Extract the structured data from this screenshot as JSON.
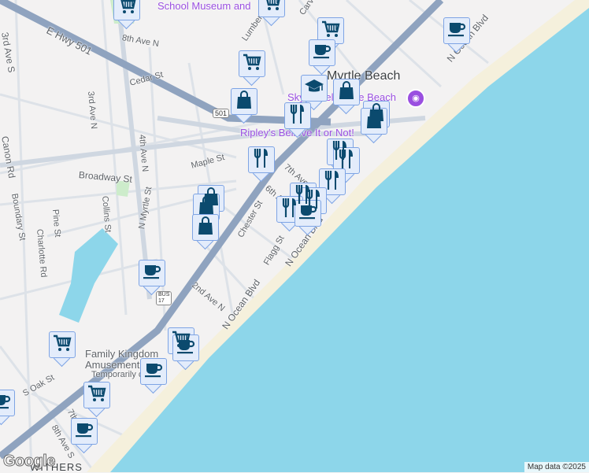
{
  "map": {
    "colors": {
      "water": "#8dd6ea",
      "land": "#f3f2f2",
      "highway": "#8fa3bf",
      "road": "#d6dde6",
      "beach": "#f5f0dc",
      "park": "#cdeccb",
      "marker_bg": "#e3ecfb",
      "icon": "#0b4a6e",
      "poi": "#9a4fe0"
    },
    "city_label": "Myrtle Beach",
    "poi_labels": [
      "Ripley's Believe It or Not!",
      "SkyWheel Myrtle Beach",
      "Family Kingdom Amusement Park",
      "Temporarily closed",
      "School Museum and"
    ],
    "street_labels": [
      "E Hwy 501",
      "8th Ave N",
      "3rd Ave S",
      "3rd Ave N",
      "Cedar St",
      "4th Ave N",
      "Canon Rd",
      "Broadway St",
      "Maple St",
      "Boundary St",
      "Collins St",
      "N Myrtle St",
      "Chester St",
      "Flagg St",
      "7th Ave N",
      "6th Ave N",
      "2nd Ave N",
      "N Ocean Blvd",
      "N Ocean Blvd",
      "N Ocean Blvd",
      "Lumber St",
      "Carver St",
      "Charlotte Rd",
      "S Oak St",
      "7th Ave S",
      "8th Ave S",
      "WITHERS",
      "Pine St"
    ],
    "shields": [
      "501",
      "BUS 17"
    ],
    "attribution": "Map data ©2025",
    "logo": "Google"
  },
  "markers": [
    {
      "type": "cart-icon"
    },
    {
      "type": "cart-icon"
    },
    {
      "type": "cart-icon"
    },
    {
      "type": "coffee-icon"
    },
    {
      "type": "cart-icon"
    },
    {
      "type": "coffee-icon"
    },
    {
      "type": "school-icon"
    },
    {
      "type": "bag-icon"
    },
    {
      "type": "bag-icon"
    },
    {
      "type": "bag-icon"
    },
    {
      "type": "bag-icon"
    },
    {
      "type": "restaurant-icon"
    },
    {
      "type": "restaurant-icon"
    },
    {
      "type": "restaurant-icon"
    },
    {
      "type": "restaurant-icon"
    },
    {
      "type": "restaurant-icon"
    },
    {
      "type": "bag-icon"
    },
    {
      "type": "bag-icon"
    },
    {
      "type": "restaurant-icon"
    },
    {
      "type": "restaurant-icon"
    },
    {
      "type": "restaurant-icon"
    },
    {
      "type": "coffee-icon"
    },
    {
      "type": "bag-icon"
    },
    {
      "type": "coffee-icon"
    },
    {
      "type": "cart-icon"
    },
    {
      "type": "coffee-icon"
    },
    {
      "type": "cart-icon"
    },
    {
      "type": "coffee-icon"
    },
    {
      "type": "cart-icon"
    },
    {
      "type": "coffee-icon"
    },
    {
      "type": "coffee-icon"
    }
  ]
}
